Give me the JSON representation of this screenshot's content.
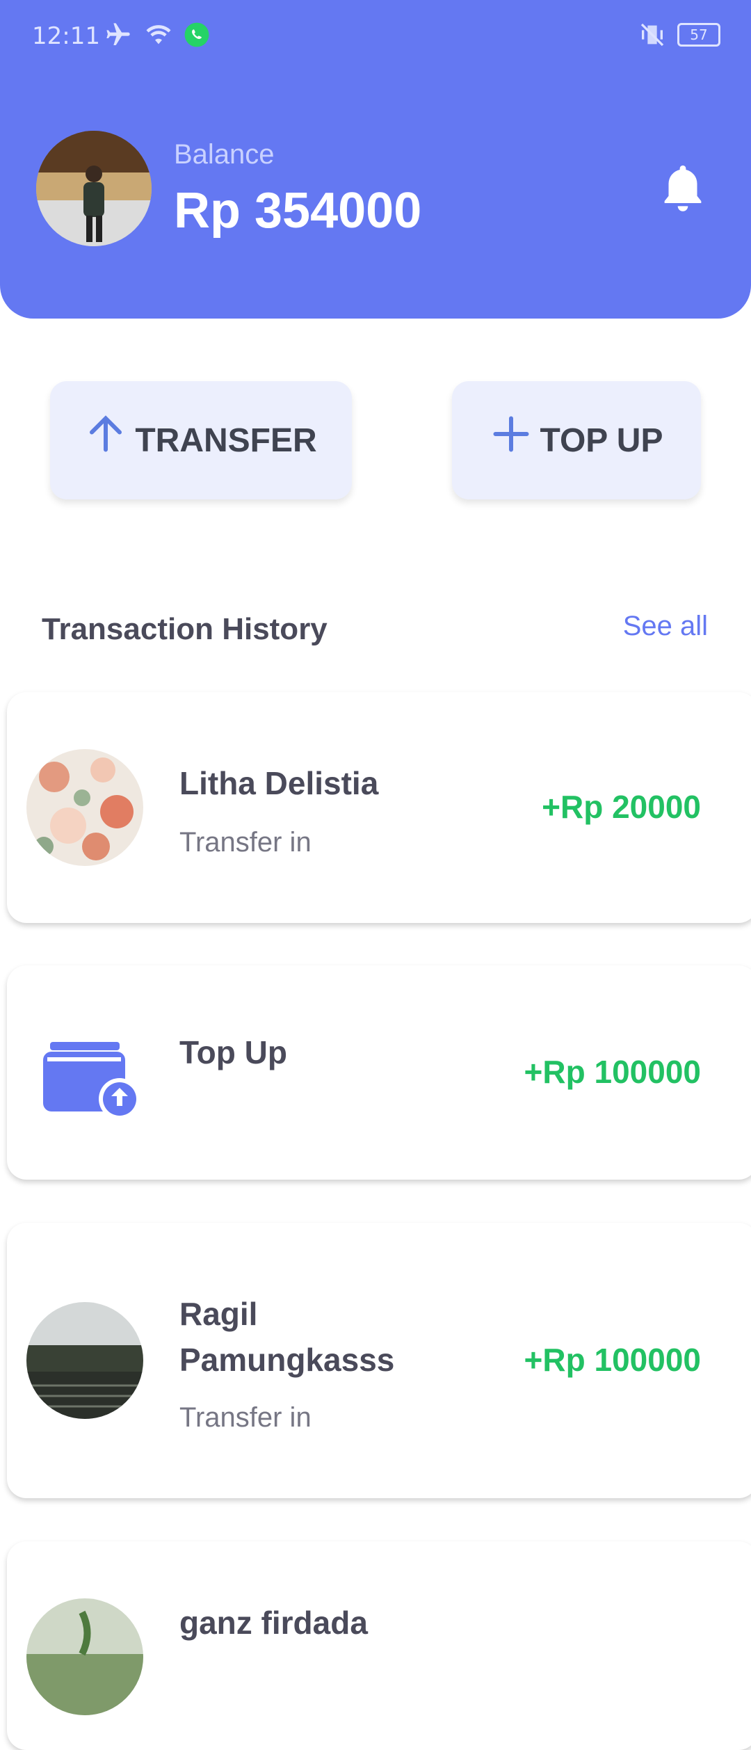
{
  "status_bar": {
    "time": "12:11",
    "battery": "57"
  },
  "header": {
    "balance_label": "Balance",
    "balance_value": "Rp 354000"
  },
  "actions": {
    "transfer_label": "TRANSFER",
    "topup_label": "TOP UP"
  },
  "history": {
    "title": "Transaction History",
    "see_all": "See all",
    "items": [
      {
        "name": "Litha Delistia",
        "type": "Transfer in",
        "amount": "+Rp 20000"
      },
      {
        "name": "Top Up",
        "type": "",
        "amount": "+Rp 100000"
      },
      {
        "name": "Ragil Pamungkasss",
        "type": "Transfer in",
        "amount": "+Rp 100000"
      },
      {
        "name": "ganz firdada",
        "type": "",
        "amount": ""
      }
    ]
  },
  "colors": {
    "primary": "#6478f2",
    "positive": "#22c163",
    "button_bg": "#eceffd"
  },
  "icons": [
    "airplane-icon",
    "wifi-icon",
    "whatsapp-icon",
    "vibrate-off-icon",
    "battery-icon",
    "bell-icon",
    "arrow-up-icon",
    "plus-icon",
    "wallet-upload-icon"
  ]
}
